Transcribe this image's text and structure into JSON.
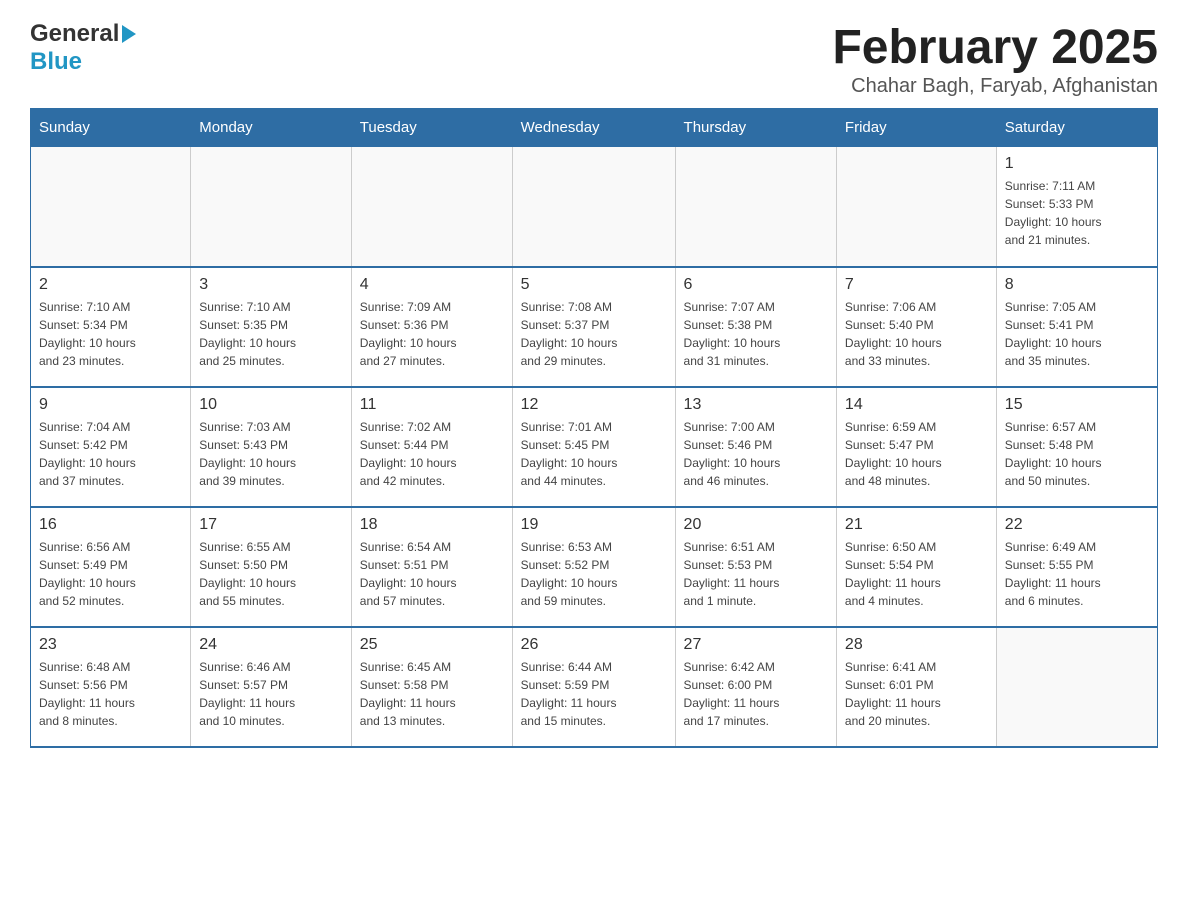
{
  "header": {
    "logo_general": "General",
    "logo_blue": "Blue",
    "title": "February 2025",
    "subtitle": "Chahar Bagh, Faryab, Afghanistan"
  },
  "calendar": {
    "days_of_week": [
      "Sunday",
      "Monday",
      "Tuesday",
      "Wednesday",
      "Thursday",
      "Friday",
      "Saturday"
    ],
    "weeks": [
      [
        {
          "day": "",
          "info": ""
        },
        {
          "day": "",
          "info": ""
        },
        {
          "day": "",
          "info": ""
        },
        {
          "day": "",
          "info": ""
        },
        {
          "day": "",
          "info": ""
        },
        {
          "day": "",
          "info": ""
        },
        {
          "day": "1",
          "info": "Sunrise: 7:11 AM\nSunset: 5:33 PM\nDaylight: 10 hours\nand 21 minutes."
        }
      ],
      [
        {
          "day": "2",
          "info": "Sunrise: 7:10 AM\nSunset: 5:34 PM\nDaylight: 10 hours\nand 23 minutes."
        },
        {
          "day": "3",
          "info": "Sunrise: 7:10 AM\nSunset: 5:35 PM\nDaylight: 10 hours\nand 25 minutes."
        },
        {
          "day": "4",
          "info": "Sunrise: 7:09 AM\nSunset: 5:36 PM\nDaylight: 10 hours\nand 27 minutes."
        },
        {
          "day": "5",
          "info": "Sunrise: 7:08 AM\nSunset: 5:37 PM\nDaylight: 10 hours\nand 29 minutes."
        },
        {
          "day": "6",
          "info": "Sunrise: 7:07 AM\nSunset: 5:38 PM\nDaylight: 10 hours\nand 31 minutes."
        },
        {
          "day": "7",
          "info": "Sunrise: 7:06 AM\nSunset: 5:40 PM\nDaylight: 10 hours\nand 33 minutes."
        },
        {
          "day": "8",
          "info": "Sunrise: 7:05 AM\nSunset: 5:41 PM\nDaylight: 10 hours\nand 35 minutes."
        }
      ],
      [
        {
          "day": "9",
          "info": "Sunrise: 7:04 AM\nSunset: 5:42 PM\nDaylight: 10 hours\nand 37 minutes."
        },
        {
          "day": "10",
          "info": "Sunrise: 7:03 AM\nSunset: 5:43 PM\nDaylight: 10 hours\nand 39 minutes."
        },
        {
          "day": "11",
          "info": "Sunrise: 7:02 AM\nSunset: 5:44 PM\nDaylight: 10 hours\nand 42 minutes."
        },
        {
          "day": "12",
          "info": "Sunrise: 7:01 AM\nSunset: 5:45 PM\nDaylight: 10 hours\nand 44 minutes."
        },
        {
          "day": "13",
          "info": "Sunrise: 7:00 AM\nSunset: 5:46 PM\nDaylight: 10 hours\nand 46 minutes."
        },
        {
          "day": "14",
          "info": "Sunrise: 6:59 AM\nSunset: 5:47 PM\nDaylight: 10 hours\nand 48 minutes."
        },
        {
          "day": "15",
          "info": "Sunrise: 6:57 AM\nSunset: 5:48 PM\nDaylight: 10 hours\nand 50 minutes."
        }
      ],
      [
        {
          "day": "16",
          "info": "Sunrise: 6:56 AM\nSunset: 5:49 PM\nDaylight: 10 hours\nand 52 minutes."
        },
        {
          "day": "17",
          "info": "Sunrise: 6:55 AM\nSunset: 5:50 PM\nDaylight: 10 hours\nand 55 minutes."
        },
        {
          "day": "18",
          "info": "Sunrise: 6:54 AM\nSunset: 5:51 PM\nDaylight: 10 hours\nand 57 minutes."
        },
        {
          "day": "19",
          "info": "Sunrise: 6:53 AM\nSunset: 5:52 PM\nDaylight: 10 hours\nand 59 minutes."
        },
        {
          "day": "20",
          "info": "Sunrise: 6:51 AM\nSunset: 5:53 PM\nDaylight: 11 hours\nand 1 minute."
        },
        {
          "day": "21",
          "info": "Sunrise: 6:50 AM\nSunset: 5:54 PM\nDaylight: 11 hours\nand 4 minutes."
        },
        {
          "day": "22",
          "info": "Sunrise: 6:49 AM\nSunset: 5:55 PM\nDaylight: 11 hours\nand 6 minutes."
        }
      ],
      [
        {
          "day": "23",
          "info": "Sunrise: 6:48 AM\nSunset: 5:56 PM\nDaylight: 11 hours\nand 8 minutes."
        },
        {
          "day": "24",
          "info": "Sunrise: 6:46 AM\nSunset: 5:57 PM\nDaylight: 11 hours\nand 10 minutes."
        },
        {
          "day": "25",
          "info": "Sunrise: 6:45 AM\nSunset: 5:58 PM\nDaylight: 11 hours\nand 13 minutes."
        },
        {
          "day": "26",
          "info": "Sunrise: 6:44 AM\nSunset: 5:59 PM\nDaylight: 11 hours\nand 15 minutes."
        },
        {
          "day": "27",
          "info": "Sunrise: 6:42 AM\nSunset: 6:00 PM\nDaylight: 11 hours\nand 17 minutes."
        },
        {
          "day": "28",
          "info": "Sunrise: 6:41 AM\nSunset: 6:01 PM\nDaylight: 11 hours\nand 20 minutes."
        },
        {
          "day": "",
          "info": ""
        }
      ]
    ]
  }
}
